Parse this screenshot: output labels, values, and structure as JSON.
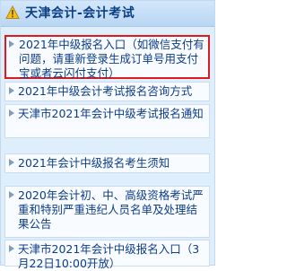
{
  "header": {
    "title": "天津会计-会计考试",
    "icon": "caution-triangle-icon",
    "accent_color": "#0b3f85",
    "highlight_color": "#e0191f"
  },
  "articles": [
    {
      "title": "2021年中级报名入口（如微信支付有问题，请重新登录生成订单号用支付宝或者云闪付支付）",
      "highlighted": true
    },
    {
      "title": "2021年中级会计考试报名咨询方式",
      "highlighted": false
    },
    {
      "title": "天津市2021年会计中级考试报名通知",
      "highlighted": false
    },
    {
      "title": "2021年会计中级报名考生须知",
      "highlighted": false
    },
    {
      "title": "2020年会计初、中、高级资格考试严重和特别严重违纪人员名单及处理结果公告",
      "highlighted": false
    },
    {
      "title": "天津市2021年会计中级报名入口（3月22日10:00开放）",
      "highlighted": false
    }
  ]
}
